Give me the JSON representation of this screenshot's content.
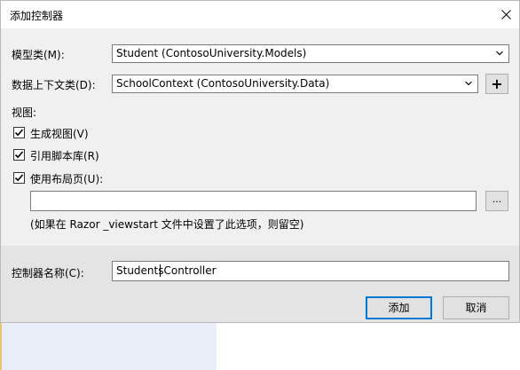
{
  "window": {
    "title": "添加控制器"
  },
  "form": {
    "model_class_label": "模型类(M):",
    "model_class_value": "Student (ContosoUniversity.Models)",
    "data_context_label": "数据上下文类(D):",
    "data_context_value": "SchoolContext (ContosoUniversity.Data)",
    "add_context_button": "+",
    "views_heading": "视图:",
    "generate_views_label": "生成视图(V)",
    "generate_views_checked": true,
    "reference_scripts_label": "引用脚本库(R)",
    "reference_scripts_checked": true,
    "use_layout_label": "使用布局页(U):",
    "use_layout_checked": true,
    "layout_path_value": "",
    "browse_button": "...",
    "layout_hint": "(如果在 Razor _viewstart 文件中设置了此选项，则留空)",
    "controller_name_label": "控制器名称(C):",
    "controller_name_value": "StudentsController"
  },
  "buttons": {
    "add": "添加",
    "cancel": "取消"
  },
  "icons": {
    "close": "close-icon",
    "dropdown": "chevron-down-icon",
    "check": "checkmark-icon"
  },
  "colors": {
    "dialog_bg": "#f0f0f0",
    "footer_bg": "#e4e4e4",
    "default_button_border": "#0078d7"
  }
}
